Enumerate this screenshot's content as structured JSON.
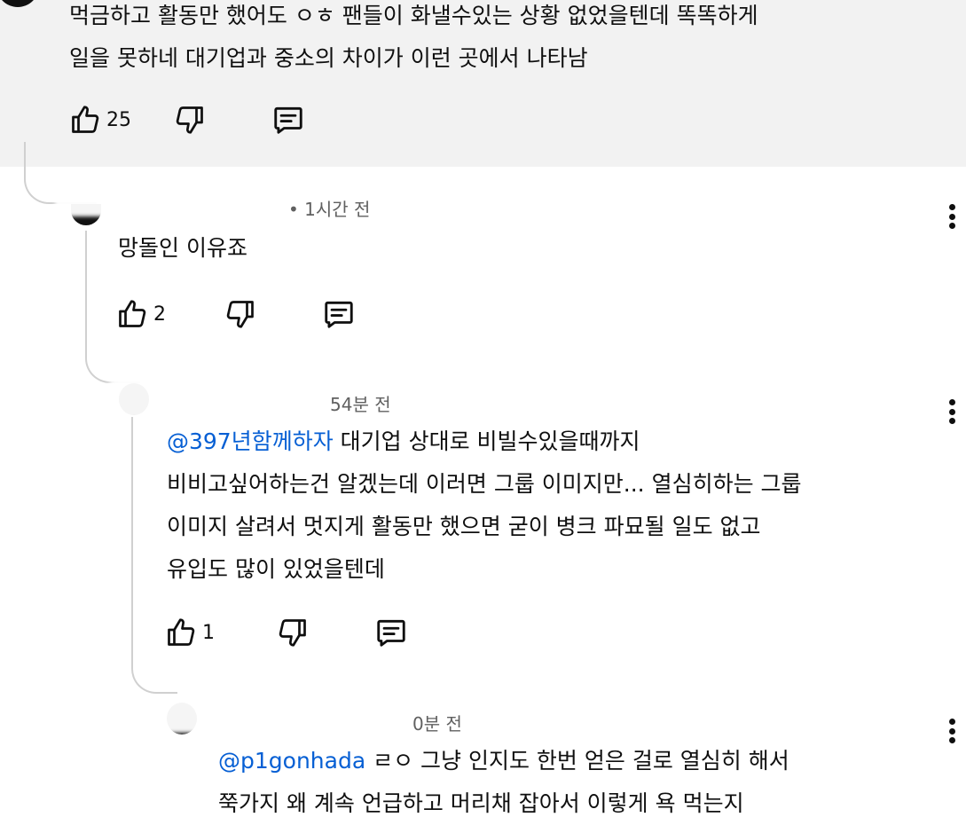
{
  "comment_top": {
    "lines": [
      "먹금하고 활동만 했어도 ㅇㅎ 팬들이 화낼수있는 상황 없었을텐데 똑똑하게",
      "일을 못하네 대기업과 중소의 차이가 이런 곳에서  나타남"
    ],
    "likes": "25"
  },
  "reply1": {
    "time": "• 1시간 전",
    "text": "망돌인 이유죠",
    "likes": "2"
  },
  "reply2": {
    "time": "54분 전",
    "mention": "@397년함께하자",
    "first_line": "  대기업 상대로 비빌수있을때까지",
    "lines": [
      "비비고싶어하는건 알겠는데 이러면 그룹 이미지만... 열심히하는 그룹",
      "이미지 살려서 멋지게 활동만 했으면 굳이 병크 파묘될 일도 없고",
      "유입도 많이 있었을텐데"
    ],
    "likes": "1"
  },
  "reply3": {
    "time": "0분 전",
    "mention": "@p1gonhada",
    "first_line": " ㄹㅇ 그냥 인지도 한번 얻은 걸로 열심히 해서",
    "lines": [
      "쭉가지 왜 계속 언급하고 머리채 잡아서 이렇게 욕 먹는지"
    ]
  },
  "icons": {
    "like": "thumbs-up-icon",
    "dislike": "thumbs-down-icon",
    "reply": "comment-reply-icon",
    "more": "more-vert-icon"
  }
}
